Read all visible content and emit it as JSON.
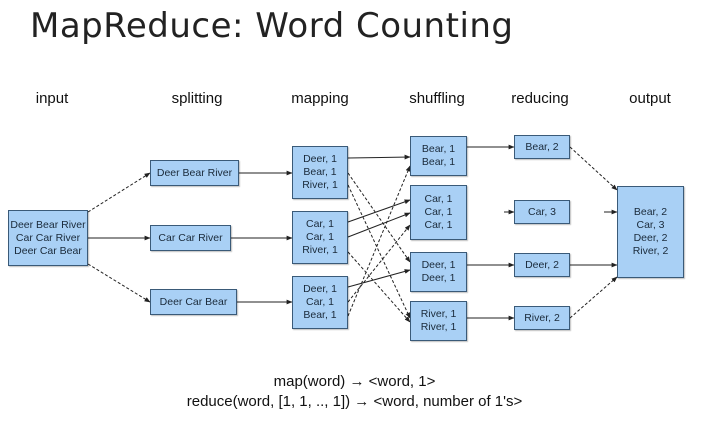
{
  "title": "MapReduce: Word Counting",
  "stages": [
    "input",
    "splitting",
    "mapping",
    "shuffling",
    "reducing",
    "output"
  ],
  "input": [
    "Deer Bear River",
    "Car Car River",
    "Deer Car Bear"
  ],
  "splitting": [
    [
      "Deer Bear River"
    ],
    [
      "Car Car River"
    ],
    [
      "Deer Car Bear"
    ]
  ],
  "mapping": [
    [
      "Deer, 1",
      "Bear, 1",
      "River, 1"
    ],
    [
      "Car, 1",
      "Car, 1",
      "River, 1"
    ],
    [
      "Deer, 1",
      "Car, 1",
      "Bear, 1"
    ]
  ],
  "shuffling": [
    [
      "Bear, 1",
      "Bear, 1"
    ],
    [
      "Car, 1",
      "Car, 1",
      "Car, 1"
    ],
    [
      "Deer, 1",
      "Deer, 1"
    ],
    [
      "River, 1",
      "River, 1"
    ]
  ],
  "reducing": [
    [
      "Bear, 2"
    ],
    [
      "Car, 3"
    ],
    [
      "Deer, 2"
    ],
    [
      "River, 2"
    ]
  ],
  "output": [
    "Bear, 2",
    "Car, 3",
    "Deer, 2",
    "River, 2"
  ],
  "formulas": [
    "map(word) → <word, 1>",
    "reduce(word, [1, 1, .., 1]) → <word, number of 1's>"
  ],
  "colors": {
    "box_fill": "#a9d0f5",
    "box_border": "#3a5a78",
    "edge": "#222222"
  }
}
